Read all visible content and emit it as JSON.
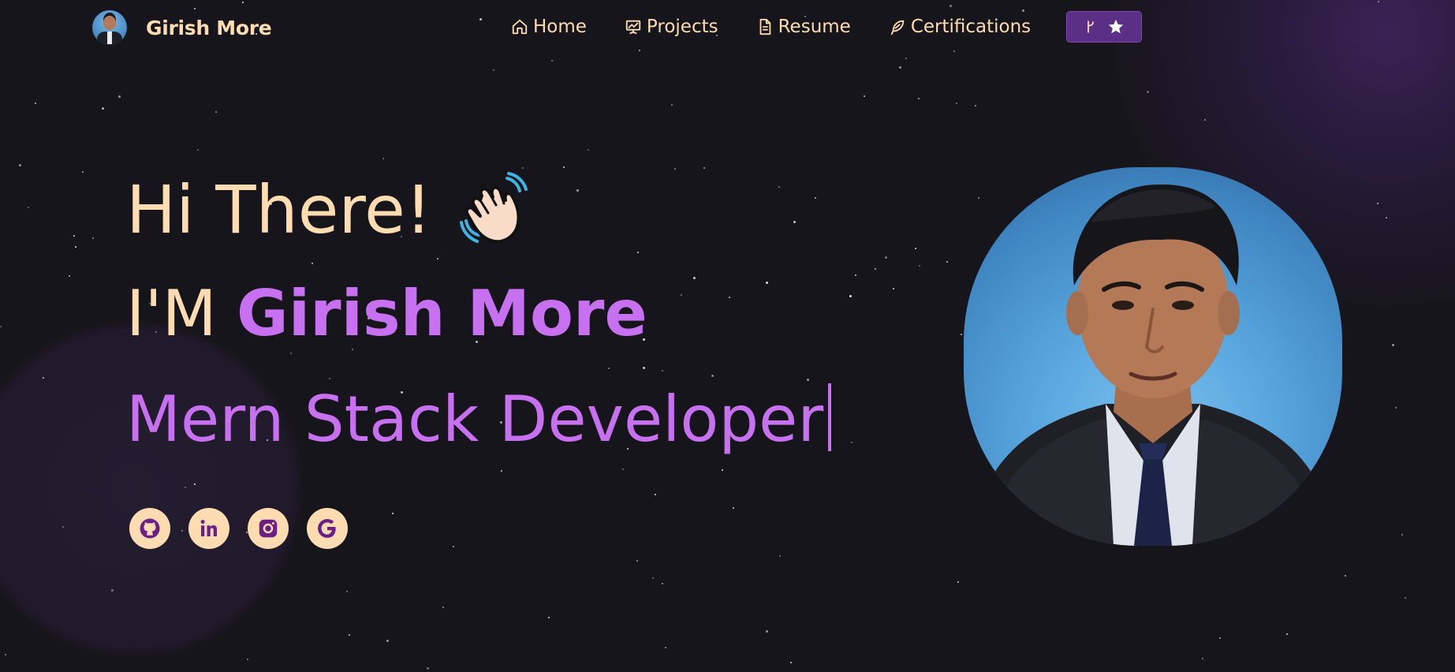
{
  "brand": {
    "name": "Girish More",
    "avatar_icon": "profile-avatar"
  },
  "nav": {
    "items": [
      {
        "label": "Home",
        "icon": "home-icon"
      },
      {
        "label": "Projects",
        "icon": "presentation-icon"
      },
      {
        "label": "Resume",
        "icon": "document-icon"
      },
      {
        "label": "Certifications",
        "icon": "feather-pen-icon"
      }
    ],
    "fork_button": {
      "icons": [
        "git-branch-icon",
        "star-icon"
      ]
    }
  },
  "hero": {
    "greeting": "Hi There!",
    "greeting_emoji": "waving-hand",
    "intro_prefix": "I'M ",
    "intro_name": "Girish More",
    "role": "Mern Stack Developer"
  },
  "socials": [
    {
      "icon": "github-icon"
    },
    {
      "icon": "linkedin-icon"
    },
    {
      "icon": "instagram-icon"
    },
    {
      "icon": "google-icon"
    }
  ],
  "colors": {
    "background": "#16151b",
    "accent_purple": "#c770f0",
    "text_cream": "#fcdcb0",
    "button_purple": "#5b2f86"
  }
}
